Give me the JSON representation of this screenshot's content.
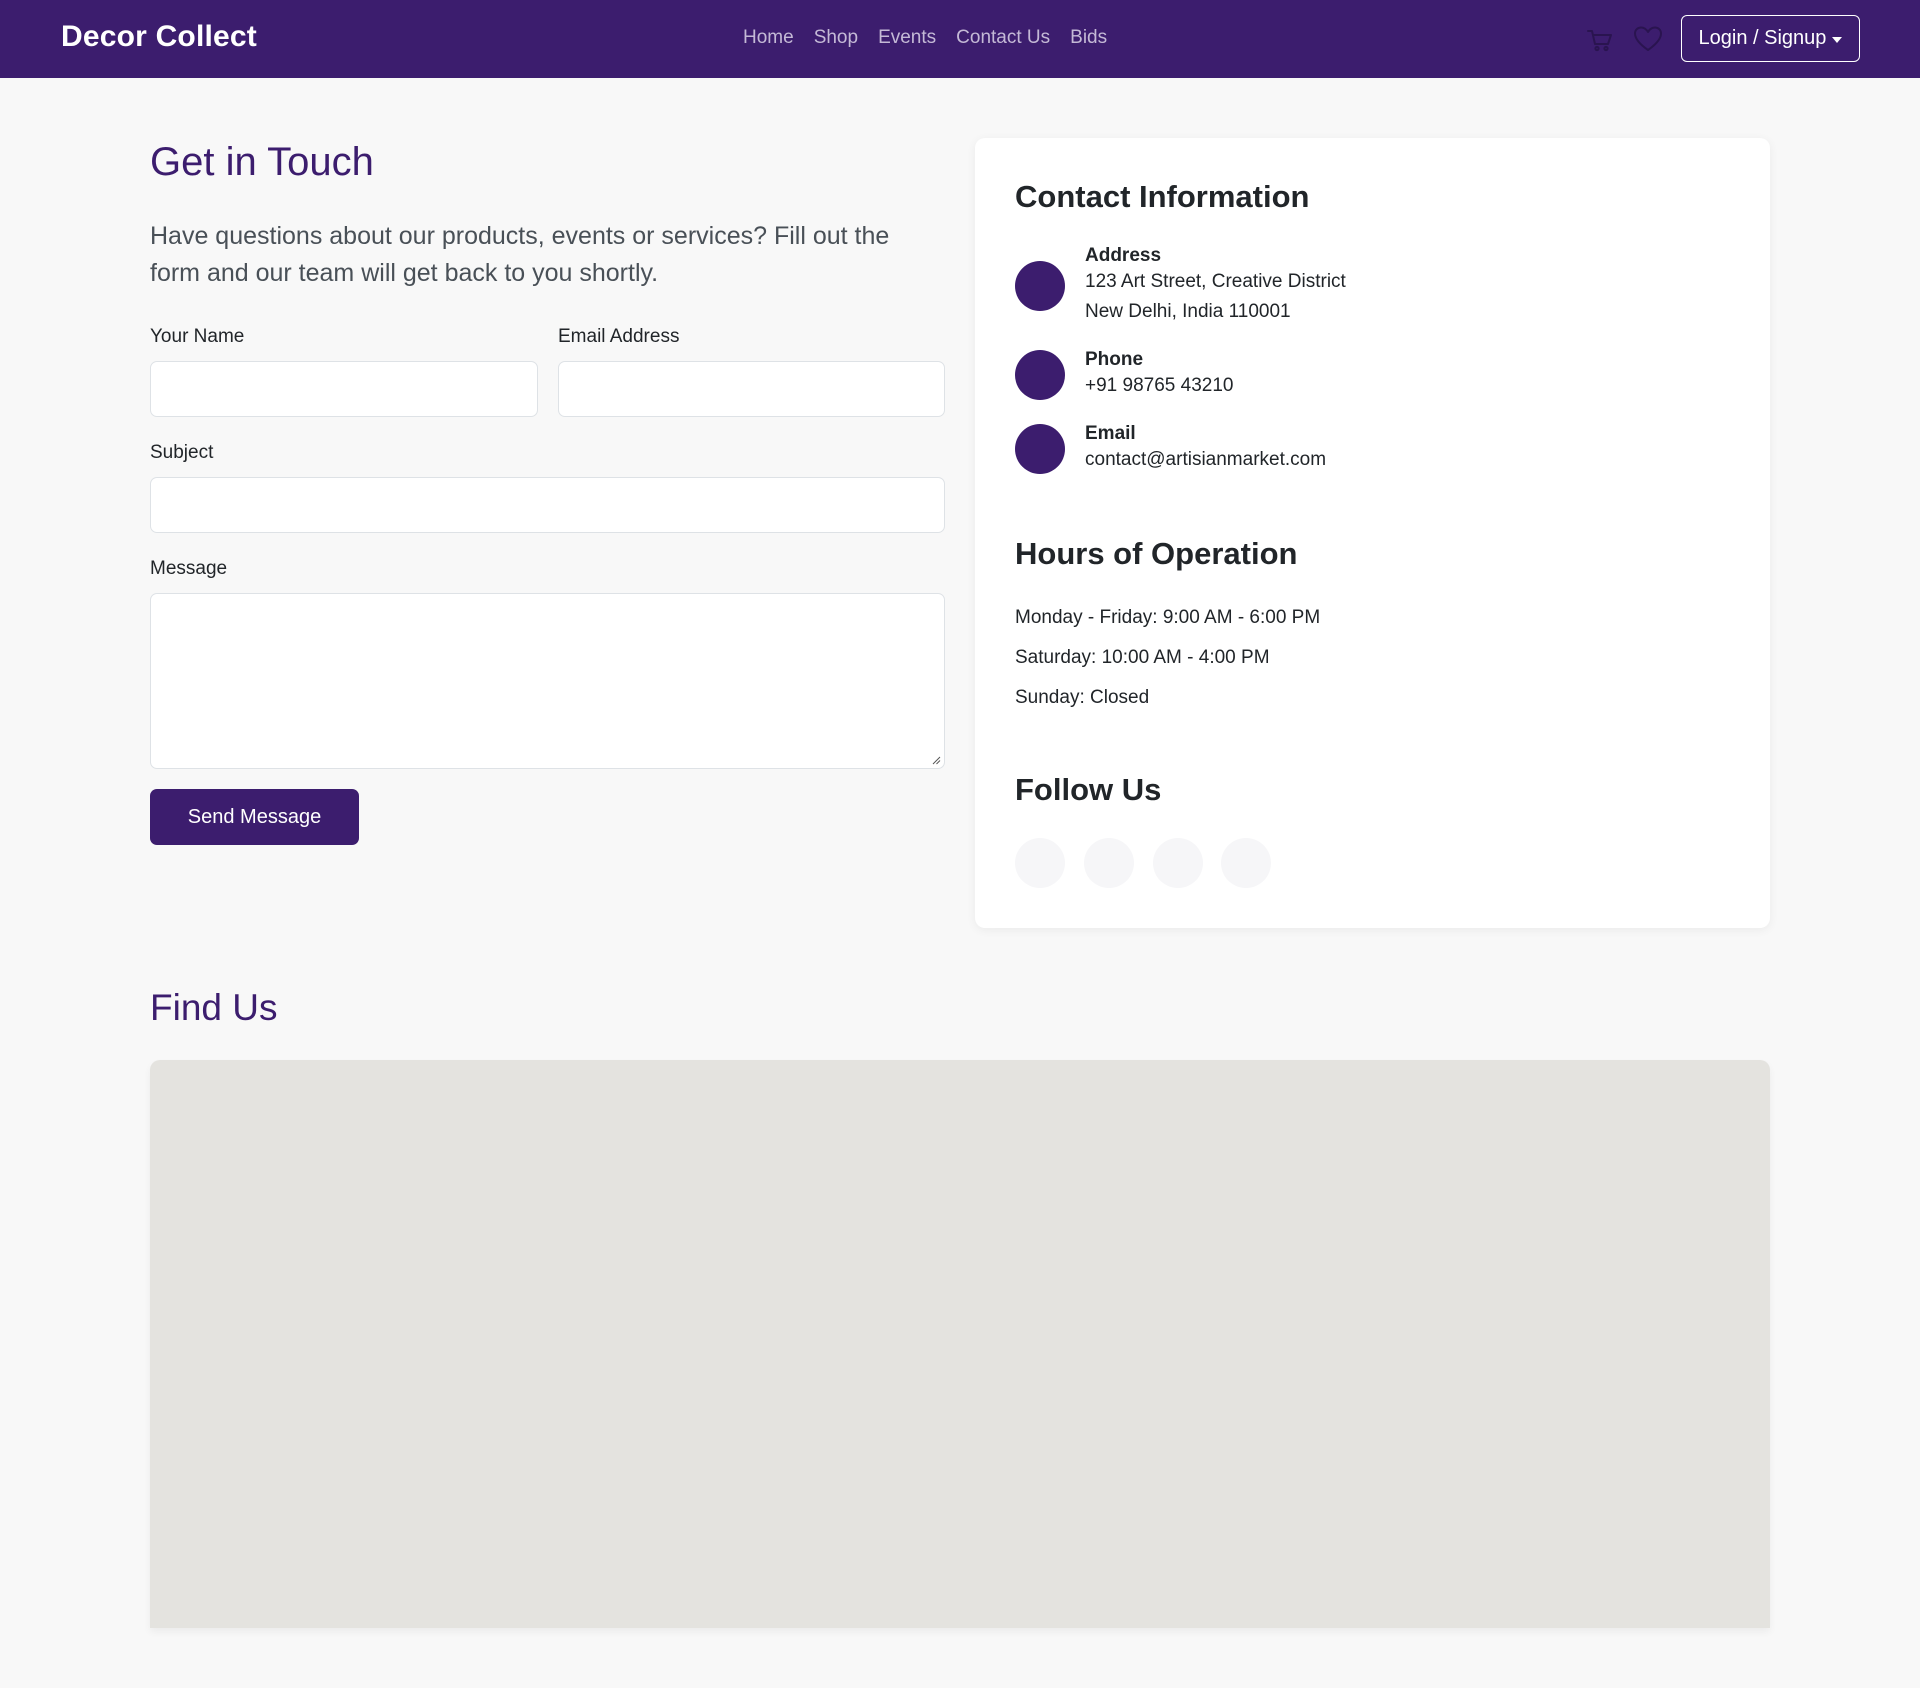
{
  "navbar": {
    "brand": "Decor Collect",
    "links": [
      "Home",
      "Shop",
      "Events",
      "Contact Us",
      "Bids"
    ],
    "cart_icon": "cart-icon",
    "wishlist_icon": "heart-icon",
    "login_label": "Login / Signup"
  },
  "contact_form": {
    "title": "Get in Touch",
    "intro": "Have questions about our products, events or services? Fill out the form and our team will get back to you shortly.",
    "name_label": "Your Name",
    "name_value": "",
    "email_label": "Email Address",
    "email_value": "",
    "subject_label": "Subject",
    "subject_value": "",
    "message_label": "Message",
    "message_value": "",
    "submit_label": "Send Message"
  },
  "contact_info": {
    "title": "Contact Information",
    "address_label": "Address",
    "address_line1": "123 Art Street, Creative District",
    "address_line2": "New Delhi, India 110001",
    "phone_label": "Phone",
    "phone_value": "+91 98765 43210",
    "email_label": "Email",
    "email_value": "contact@artisianmarket.com"
  },
  "hours": {
    "title": "Hours of Operation",
    "lines": [
      "Monday - Friday: 9:00 AM - 6:00 PM",
      "Saturday: 10:00 AM - 4:00 PM",
      "Sunday: Closed"
    ]
  },
  "follow": {
    "title": "Follow Us",
    "social_count": 4
  },
  "find_us": {
    "title": "Find Us"
  },
  "colors": {
    "brand": "#3c1d6e",
    "page_bg": "#f8f8f8",
    "map_bg": "#e4e3df"
  }
}
